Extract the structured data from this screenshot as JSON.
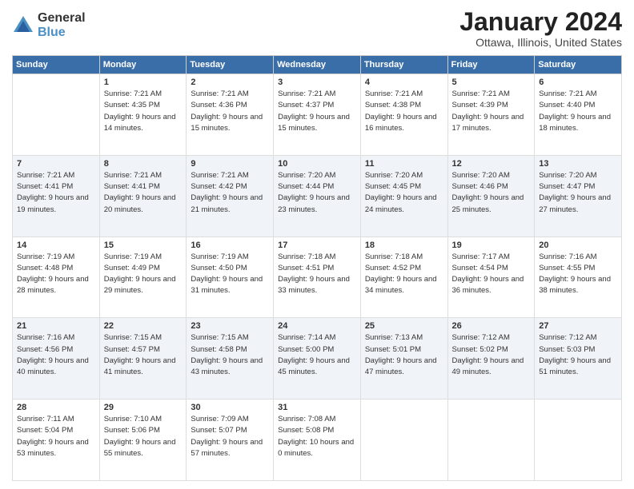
{
  "logo": {
    "general": "General",
    "blue": "Blue"
  },
  "title": "January 2024",
  "location": "Ottawa, Illinois, United States",
  "weekdays": [
    "Sunday",
    "Monday",
    "Tuesday",
    "Wednesday",
    "Thursday",
    "Friday",
    "Saturday"
  ],
  "weeks": [
    [
      {
        "day": "",
        "sunrise": "",
        "sunset": "",
        "daylight": ""
      },
      {
        "day": "1",
        "sunrise": "Sunrise: 7:21 AM",
        "sunset": "Sunset: 4:35 PM",
        "daylight": "Daylight: 9 hours and 14 minutes."
      },
      {
        "day": "2",
        "sunrise": "Sunrise: 7:21 AM",
        "sunset": "Sunset: 4:36 PM",
        "daylight": "Daylight: 9 hours and 15 minutes."
      },
      {
        "day": "3",
        "sunrise": "Sunrise: 7:21 AM",
        "sunset": "Sunset: 4:37 PM",
        "daylight": "Daylight: 9 hours and 15 minutes."
      },
      {
        "day": "4",
        "sunrise": "Sunrise: 7:21 AM",
        "sunset": "Sunset: 4:38 PM",
        "daylight": "Daylight: 9 hours and 16 minutes."
      },
      {
        "day": "5",
        "sunrise": "Sunrise: 7:21 AM",
        "sunset": "Sunset: 4:39 PM",
        "daylight": "Daylight: 9 hours and 17 minutes."
      },
      {
        "day": "6",
        "sunrise": "Sunrise: 7:21 AM",
        "sunset": "Sunset: 4:40 PM",
        "daylight": "Daylight: 9 hours and 18 minutes."
      }
    ],
    [
      {
        "day": "7",
        "sunrise": "Sunrise: 7:21 AM",
        "sunset": "Sunset: 4:41 PM",
        "daylight": "Daylight: 9 hours and 19 minutes."
      },
      {
        "day": "8",
        "sunrise": "Sunrise: 7:21 AM",
        "sunset": "Sunset: 4:41 PM",
        "daylight": "Daylight: 9 hours and 20 minutes."
      },
      {
        "day": "9",
        "sunrise": "Sunrise: 7:21 AM",
        "sunset": "Sunset: 4:42 PM",
        "daylight": "Daylight: 9 hours and 21 minutes."
      },
      {
        "day": "10",
        "sunrise": "Sunrise: 7:20 AM",
        "sunset": "Sunset: 4:44 PM",
        "daylight": "Daylight: 9 hours and 23 minutes."
      },
      {
        "day": "11",
        "sunrise": "Sunrise: 7:20 AM",
        "sunset": "Sunset: 4:45 PM",
        "daylight": "Daylight: 9 hours and 24 minutes."
      },
      {
        "day": "12",
        "sunrise": "Sunrise: 7:20 AM",
        "sunset": "Sunset: 4:46 PM",
        "daylight": "Daylight: 9 hours and 25 minutes."
      },
      {
        "day": "13",
        "sunrise": "Sunrise: 7:20 AM",
        "sunset": "Sunset: 4:47 PM",
        "daylight": "Daylight: 9 hours and 27 minutes."
      }
    ],
    [
      {
        "day": "14",
        "sunrise": "Sunrise: 7:19 AM",
        "sunset": "Sunset: 4:48 PM",
        "daylight": "Daylight: 9 hours and 28 minutes."
      },
      {
        "day": "15",
        "sunrise": "Sunrise: 7:19 AM",
        "sunset": "Sunset: 4:49 PM",
        "daylight": "Daylight: 9 hours and 29 minutes."
      },
      {
        "day": "16",
        "sunrise": "Sunrise: 7:19 AM",
        "sunset": "Sunset: 4:50 PM",
        "daylight": "Daylight: 9 hours and 31 minutes."
      },
      {
        "day": "17",
        "sunrise": "Sunrise: 7:18 AM",
        "sunset": "Sunset: 4:51 PM",
        "daylight": "Daylight: 9 hours and 33 minutes."
      },
      {
        "day": "18",
        "sunrise": "Sunrise: 7:18 AM",
        "sunset": "Sunset: 4:52 PM",
        "daylight": "Daylight: 9 hours and 34 minutes."
      },
      {
        "day": "19",
        "sunrise": "Sunrise: 7:17 AM",
        "sunset": "Sunset: 4:54 PM",
        "daylight": "Daylight: 9 hours and 36 minutes."
      },
      {
        "day": "20",
        "sunrise": "Sunrise: 7:16 AM",
        "sunset": "Sunset: 4:55 PM",
        "daylight": "Daylight: 9 hours and 38 minutes."
      }
    ],
    [
      {
        "day": "21",
        "sunrise": "Sunrise: 7:16 AM",
        "sunset": "Sunset: 4:56 PM",
        "daylight": "Daylight: 9 hours and 40 minutes."
      },
      {
        "day": "22",
        "sunrise": "Sunrise: 7:15 AM",
        "sunset": "Sunset: 4:57 PM",
        "daylight": "Daylight: 9 hours and 41 minutes."
      },
      {
        "day": "23",
        "sunrise": "Sunrise: 7:15 AM",
        "sunset": "Sunset: 4:58 PM",
        "daylight": "Daylight: 9 hours and 43 minutes."
      },
      {
        "day": "24",
        "sunrise": "Sunrise: 7:14 AM",
        "sunset": "Sunset: 5:00 PM",
        "daylight": "Daylight: 9 hours and 45 minutes."
      },
      {
        "day": "25",
        "sunrise": "Sunrise: 7:13 AM",
        "sunset": "Sunset: 5:01 PM",
        "daylight": "Daylight: 9 hours and 47 minutes."
      },
      {
        "day": "26",
        "sunrise": "Sunrise: 7:12 AM",
        "sunset": "Sunset: 5:02 PM",
        "daylight": "Daylight: 9 hours and 49 minutes."
      },
      {
        "day": "27",
        "sunrise": "Sunrise: 7:12 AM",
        "sunset": "Sunset: 5:03 PM",
        "daylight": "Daylight: 9 hours and 51 minutes."
      }
    ],
    [
      {
        "day": "28",
        "sunrise": "Sunrise: 7:11 AM",
        "sunset": "Sunset: 5:04 PM",
        "daylight": "Daylight: 9 hours and 53 minutes."
      },
      {
        "day": "29",
        "sunrise": "Sunrise: 7:10 AM",
        "sunset": "Sunset: 5:06 PM",
        "daylight": "Daylight: 9 hours and 55 minutes."
      },
      {
        "day": "30",
        "sunrise": "Sunrise: 7:09 AM",
        "sunset": "Sunset: 5:07 PM",
        "daylight": "Daylight: 9 hours and 57 minutes."
      },
      {
        "day": "31",
        "sunrise": "Sunrise: 7:08 AM",
        "sunset": "Sunset: 5:08 PM",
        "daylight": "Daylight: 10 hours and 0 minutes."
      },
      {
        "day": "",
        "sunrise": "",
        "sunset": "",
        "daylight": ""
      },
      {
        "day": "",
        "sunrise": "",
        "sunset": "",
        "daylight": ""
      },
      {
        "day": "",
        "sunrise": "",
        "sunset": "",
        "daylight": ""
      }
    ]
  ]
}
